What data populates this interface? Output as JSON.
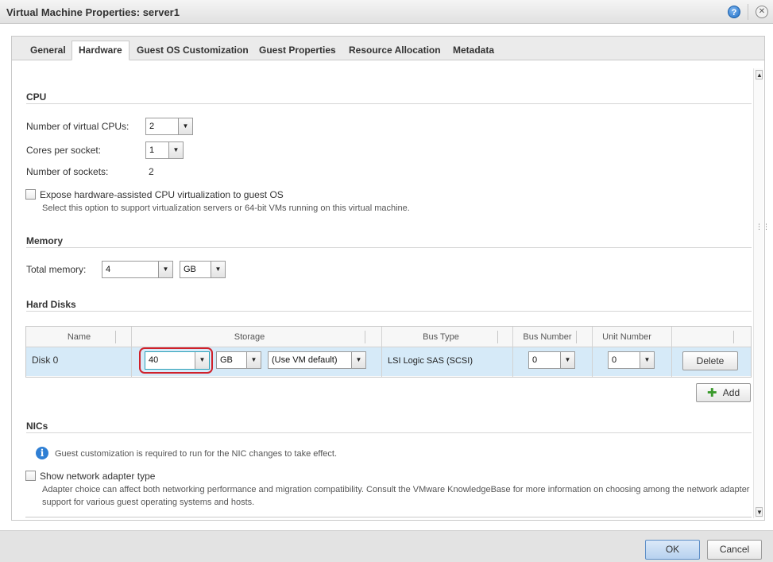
{
  "window": {
    "title": "Virtual Machine Properties: server1",
    "help_icon": "question-icon",
    "close_icon": "close-icon"
  },
  "tabs": [
    {
      "label": "General",
      "active": false
    },
    {
      "label": "Hardware",
      "active": true
    },
    {
      "label": "Guest OS Customization",
      "active": false
    },
    {
      "label": "Guest Properties",
      "active": false
    },
    {
      "label": "Resource Allocation",
      "active": false
    },
    {
      "label": "Metadata",
      "active": false
    }
  ],
  "cpu": {
    "title": "CPU",
    "vcpus_label": "Number of virtual CPUs:",
    "vcpus_value": "2",
    "cores_label": "Cores per socket:",
    "cores_value": "1",
    "sockets_label": "Number of sockets:",
    "sockets_value": "2",
    "expose_label": "Expose hardware-assisted CPU virtualization to guest OS",
    "expose_checked": false,
    "expose_hint": "Select this option to support virtualization servers or 64-bit VMs running on this virtual machine."
  },
  "memory": {
    "title": "Memory",
    "total_label": "Total memory:",
    "total_value": "4",
    "unit_value": "GB"
  },
  "hard_disks": {
    "title": "Hard Disks",
    "columns": [
      "Name",
      "Storage",
      "Bus Type",
      "Bus Number",
      "Unit Number"
    ],
    "rows": [
      {
        "name": "Disk 0",
        "size": "40",
        "size_unit": "GB",
        "storage_policy": "(Use VM default)",
        "bus_type": "LSI Logic SAS (SCSI)",
        "bus_number": "0",
        "unit_number": "0",
        "delete_label": "Delete"
      }
    ],
    "add_label": "Add",
    "add_icon": "plus-icon"
  },
  "nics": {
    "title": "NICs",
    "info_icon": "info-icon",
    "info_text": "Guest customization is required to run for the NIC changes to take effect.",
    "show_adapter_label": "Show network adapter type",
    "show_adapter_checked": false,
    "adapter_hint_line1": "Adapter choice can affect both networking performance and migration compatibility. Consult the VMware KnowledgeBase for more information on choosing among the network adapter",
    "adapter_hint_line2": "support for various guest operating systems and hosts."
  },
  "footer": {
    "ok_label": "OK",
    "cancel_label": "Cancel"
  },
  "colors": {
    "highlight_ring": "#d0202a",
    "selected_row": "#d6eaf8",
    "add_icon": "#3a9a2c",
    "info_icon": "#2f7fd4"
  }
}
